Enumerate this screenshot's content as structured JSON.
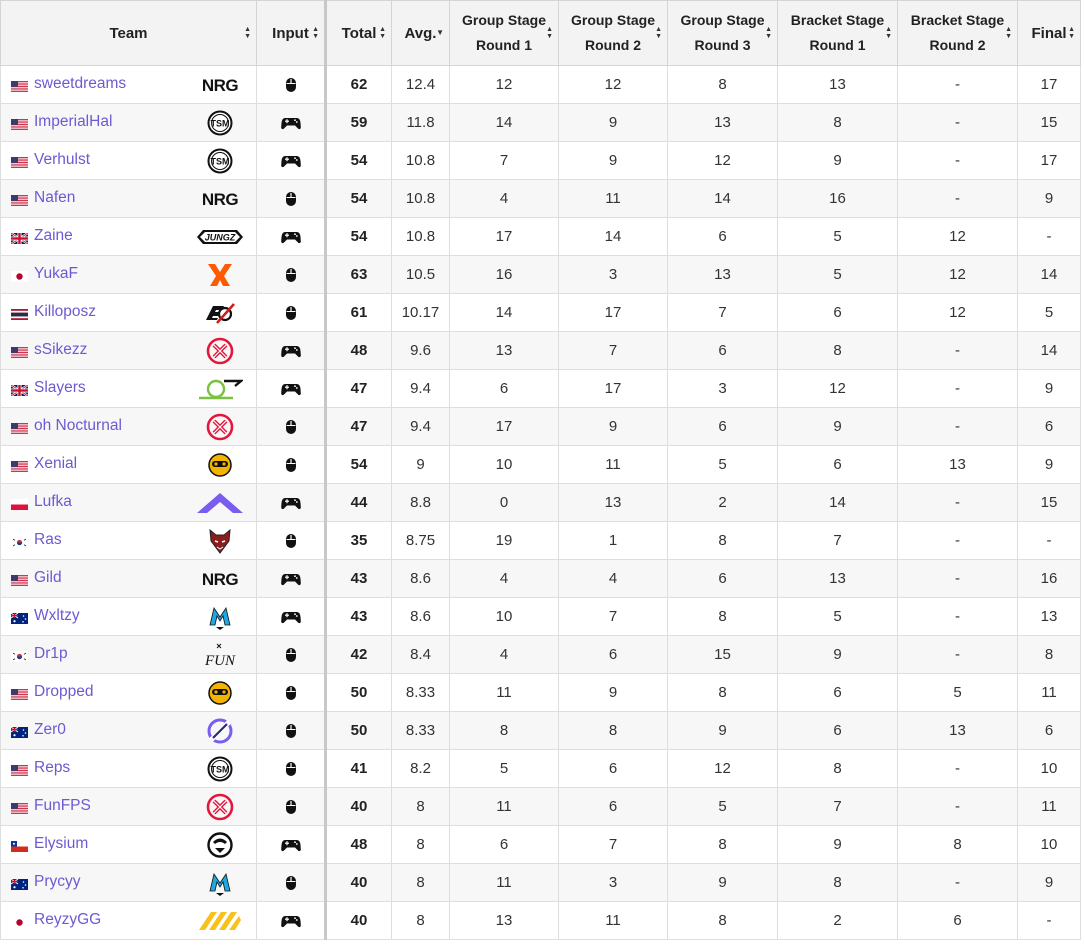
{
  "columns": [
    {
      "key": "team",
      "label": "Team",
      "label2": ""
    },
    {
      "key": "input",
      "label": "Input",
      "label2": ""
    },
    {
      "key": "total",
      "label": "Total",
      "label2": ""
    },
    {
      "key": "avg",
      "label": "Avg.",
      "label2": ""
    },
    {
      "key": "gs1",
      "label": "Group Stage",
      "label2": "Round 1"
    },
    {
      "key": "gs2",
      "label": "Group Stage",
      "label2": "Round 2"
    },
    {
      "key": "gs3",
      "label": "Group Stage",
      "label2": "Round 3"
    },
    {
      "key": "bs1",
      "label": "Bracket Stage",
      "label2": "Round 1"
    },
    {
      "key": "bs2",
      "label": "Bracket Stage",
      "label2": "Round 2"
    },
    {
      "key": "final",
      "label": "Final",
      "label2": ""
    }
  ],
  "rows": [
    {
      "flag": "us",
      "name": "sweetdreams",
      "logo": "nrg-logo",
      "input": "mouse",
      "total": "62",
      "avg": "12.4",
      "gs1": "12",
      "gs2": "12",
      "gs3": "8",
      "bs1": "13",
      "bs2": "-",
      "final": "17"
    },
    {
      "flag": "us",
      "name": "ImperialHal",
      "logo": "tsm-logo",
      "input": "controller",
      "total": "59",
      "avg": "11.8",
      "gs1": "14",
      "gs2": "9",
      "gs3": "13",
      "bs1": "8",
      "bs2": "-",
      "final": "15"
    },
    {
      "flag": "us",
      "name": "Verhulst",
      "logo": "tsm-logo",
      "input": "controller",
      "total": "54",
      "avg": "10.8",
      "gs1": "7",
      "gs2": "9",
      "gs3": "12",
      "bs1": "9",
      "bs2": "-",
      "final": "17"
    },
    {
      "flag": "us",
      "name": "Nafen",
      "logo": "nrg-logo",
      "input": "mouse",
      "total": "54",
      "avg": "10.8",
      "gs1": "4",
      "gs2": "11",
      "gs3": "14",
      "bs1": "16",
      "bs2": "-",
      "final": "9"
    },
    {
      "flag": "gb",
      "name": "Zaine",
      "logo": "jungz-logo",
      "input": "controller",
      "total": "54",
      "avg": "10.8",
      "gs1": "17",
      "gs2": "14",
      "gs3": "6",
      "bs1": "5",
      "bs2": "12",
      "final": "-"
    },
    {
      "flag": "jp",
      "name": "YukaF",
      "logo": "fnatic-logo",
      "input": "mouse",
      "total": "63",
      "avg": "10.5",
      "gs1": "16",
      "gs2": "3",
      "gs3": "13",
      "bs1": "5",
      "bs2": "12",
      "final": "14"
    },
    {
      "flag": "th",
      "name": "Killoposz",
      "logo": "exo-logo",
      "input": "mouse",
      "total": "61",
      "avg": "10.17",
      "gs1": "14",
      "gs2": "17",
      "gs3": "7",
      "bs1": "6",
      "bs2": "12",
      "final": "5"
    },
    {
      "flag": "us",
      "name": "sSikezz",
      "logo": "xset-logo",
      "input": "controller",
      "total": "48",
      "avg": "9.6",
      "gs1": "13",
      "gs2": "7",
      "gs3": "6",
      "bs1": "8",
      "bs2": "-",
      "final": "14"
    },
    {
      "flag": "gb",
      "name": "Slayers",
      "logo": "optic-logo",
      "input": "controller",
      "total": "47",
      "avg": "9.4",
      "gs1": "6",
      "gs2": "17",
      "gs3": "3",
      "bs1": "12",
      "bs2": "-",
      "final": "9"
    },
    {
      "flag": "us",
      "name": "oh Nocturnal",
      "logo": "xset-logo",
      "input": "mouse",
      "total": "47",
      "avg": "9.4",
      "gs1": "17",
      "gs2": "9",
      "gs3": "6",
      "bs1": "9",
      "bs2": "-",
      "final": "6"
    },
    {
      "flag": "us",
      "name": "Xenial",
      "logo": "spacestation-logo",
      "input": "mouse",
      "total": "54",
      "avg": "9",
      "gs1": "10",
      "gs2": "11",
      "gs3": "5",
      "bs1": "6",
      "bs2": "13",
      "final": "9"
    },
    {
      "flag": "pl",
      "name": "Lufka",
      "logo": "alliance-logo",
      "input": "controller",
      "total": "44",
      "avg": "8.8",
      "gs1": "0",
      "gs2": "13",
      "gs3": "2",
      "bs1": "14",
      "bs2": "-",
      "final": "15"
    },
    {
      "flag": "kr",
      "name": "Ras",
      "logo": "wolf-logo",
      "input": "mouse",
      "total": "35",
      "avg": "8.75",
      "gs1": "19",
      "gs2": "1",
      "gs3": "8",
      "bs1": "7",
      "bs2": "-",
      "final": "-"
    },
    {
      "flag": "us",
      "name": "Gild",
      "logo": "nrg-logo",
      "input": "controller",
      "total": "43",
      "avg": "8.6",
      "gs1": "4",
      "gs2": "4",
      "gs3": "6",
      "bs1": "13",
      "bs2": "-",
      "final": "16"
    },
    {
      "flag": "au",
      "name": "Wxltzy",
      "logo": "mindfreak-logo",
      "input": "controller",
      "total": "43",
      "avg": "8.6",
      "gs1": "10",
      "gs2": "7",
      "gs3": "8",
      "bs1": "5",
      "bs2": "-",
      "final": "13"
    },
    {
      "flag": "kr",
      "name": "Dr1p",
      "logo": "fun-logo",
      "input": "mouse",
      "total": "42",
      "avg": "8.4",
      "gs1": "4",
      "gs2": "6",
      "gs3": "15",
      "bs1": "9",
      "bs2": "-",
      "final": "8"
    },
    {
      "flag": "us",
      "name": "Dropped",
      "logo": "spacestation-logo",
      "input": "mouse",
      "total": "50",
      "avg": "8.33",
      "gs1": "11",
      "gs2": "9",
      "gs3": "8",
      "bs1": "6",
      "bs2": "5",
      "final": "11"
    },
    {
      "flag": "au",
      "name": "Zer0",
      "logo": "ring-logo",
      "input": "mouse",
      "total": "50",
      "avg": "8.33",
      "gs1": "8",
      "gs2": "8",
      "gs3": "9",
      "bs1": "6",
      "bs2": "13",
      "final": "6"
    },
    {
      "flag": "us",
      "name": "Reps",
      "logo": "tsm-logo",
      "input": "mouse",
      "total": "41",
      "avg": "8.2",
      "gs1": "5",
      "gs2": "6",
      "gs3": "12",
      "bs1": "8",
      "bs2": "-",
      "final": "10"
    },
    {
      "flag": "us",
      "name": "FunFPS",
      "logo": "xset-logo",
      "input": "mouse",
      "total": "40",
      "avg": "8",
      "gs1": "11",
      "gs2": "6",
      "gs3": "5",
      "bs1": "7",
      "bs2": "-",
      "final": "11"
    },
    {
      "flag": "cl",
      "name": "Elysium",
      "logo": "shadow-logo",
      "input": "controller",
      "total": "48",
      "avg": "8",
      "gs1": "6",
      "gs2": "7",
      "gs3": "8",
      "bs1": "9",
      "bs2": "8",
      "final": "10"
    },
    {
      "flag": "au",
      "name": "Prycyy",
      "logo": "mindfreak-logo",
      "input": "mouse",
      "total": "40",
      "avg": "8",
      "gs1": "11",
      "gs2": "3",
      "gs3": "9",
      "bs1": "8",
      "bs2": "-",
      "final": "9"
    },
    {
      "flag": "jp",
      "name": "ReyzyGG",
      "logo": "ignis-logo",
      "input": "controller",
      "total": "40",
      "avg": "8",
      "gs1": "13",
      "gs2": "11",
      "gs3": "8",
      "bs1": "2",
      "bs2": "6",
      "final": "-"
    }
  ],
  "colors": {
    "link": "#6b5bd0",
    "header_bg": "#f3f3f3",
    "row_alt": "#f7f7f7",
    "nrg": "#111111",
    "fnatic": "#ff5a00",
    "xset": "#e3163b",
    "alliance": "#7b5cf0",
    "mindfreak": "#1fa8e0",
    "spacestation": "#f2b400",
    "ignis": "#f7c21b",
    "optic": "#7ac142"
  }
}
